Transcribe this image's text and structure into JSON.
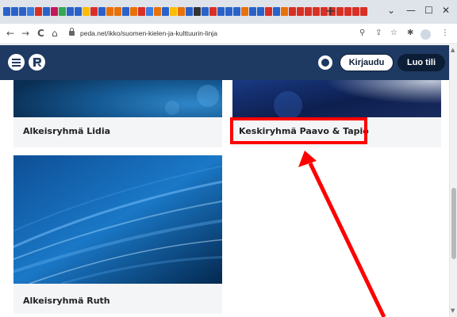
{
  "browser": {
    "url": "peda.net/ikko/suomen-kielen-ja-kulttuurin-linja",
    "new_tab_symbol": "+",
    "window_controls": {
      "dropdown": "⌄",
      "minimize": "—",
      "maximize": "☐",
      "close": "✕"
    },
    "nav": {
      "back": "←",
      "forward": "→",
      "reload": "C",
      "home": "⌂"
    },
    "toolbar_icons": {
      "search": "⚲",
      "share": "⇪",
      "star": "☆",
      "extensions": "✱",
      "menu": "⋮"
    },
    "favicon_colors": [
      "#2a62c9",
      "#2a62c9",
      "#2a62c9",
      "#3b7de0",
      "#d93025",
      "#2a62c9",
      "#c2185b",
      "#34a853",
      "#2a62c9",
      "#2a62c9",
      "#fbbc05",
      "#d93025",
      "#2a62c9",
      "#e8710a",
      "#e8710a",
      "#2a62c9",
      "#e8710a",
      "#d93025",
      "#3b7de0",
      "#e8710a",
      "#2a62c9",
      "#fbbc05",
      "#e8710a",
      "#2a62c9",
      "#333333",
      "#2a62c9",
      "#d93025",
      "#2a62c9",
      "#2a62c9",
      "#2a62c9",
      "#e8710a",
      "#2a62c9",
      "#2a62c9",
      "#d93025",
      "#2a62c9",
      "#e8710a",
      "#d93025",
      "#d93025",
      "#d93025",
      "#d93025",
      "#d93025",
      "#d93025",
      "#d93025",
      "#d93025",
      "#d93025",
      "#d93025"
    ]
  },
  "site": {
    "header_color": "#1e3a63",
    "menu_icon": "menu-icon",
    "logo_icon": "peda-logo",
    "language_icon": "globe-icon",
    "login_label": "Kirjaudu",
    "signup_label": "Luo tili"
  },
  "cards": [
    {
      "label": "Alkeisryhmä Lidia"
    },
    {
      "label": "Keskiryhmä Paavo & Tapio"
    },
    {
      "label": "Alkeisryhmä Ruth"
    }
  ],
  "annotation": {
    "color": "#ff0000"
  }
}
